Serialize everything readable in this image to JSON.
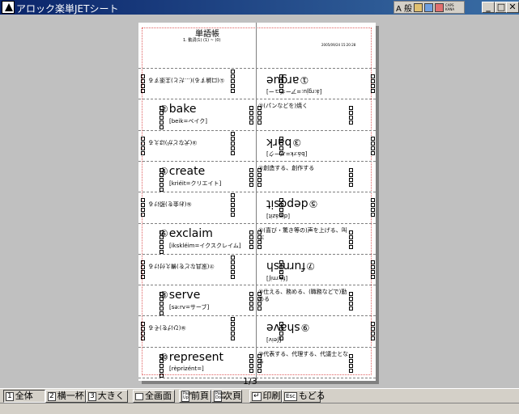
{
  "window": {
    "title": "アロック楽単JETシート"
  },
  "tray": {
    "label": "A 般",
    "extra": "CAPS KANA"
  },
  "header": {
    "title": "単語帳",
    "subtitle": "1. 動詞(1) (1) ~ (0)",
    "date": "2005/09/24 15:20:28"
  },
  "rows": [
    {
      "num": "①",
      "word": "argue",
      "pron": "[á:rgju:=アーギュー]",
      "meaning": "①(口論する)(…だと)主張する",
      "flipped": true
    },
    {
      "num": "②",
      "word": "bake",
      "pron": "[beik=ベイク]",
      "meaning": "②(パンなどを)焼く",
      "flipped": false
    },
    {
      "num": "③",
      "word": "bark",
      "pron": "[bá:rk=バーク]",
      "meaning": "③(犬などが)ほえる",
      "flipped": true
    },
    {
      "num": "④",
      "word": "create",
      "pron": "[kriéit=クリエイト]",
      "meaning": "④創造する、創作する",
      "flipped": false
    },
    {
      "num": "⑤",
      "word": "deposit",
      "pron": "[dipázit]",
      "meaning": "⑤(お金を)預ける",
      "flipped": true
    },
    {
      "num": "⑥",
      "word": "exclaim",
      "pron": "[ikskléim=イクスクレイム]",
      "meaning": "⑥(喜び・驚き等の)声を上げる、叫ぶ",
      "flipped": false
    },
    {
      "num": "⑦",
      "word": "furnish",
      "pron": "[fə́:rniʃ]",
      "meaning": "⑦(家具などを)備え付ける",
      "flipped": true
    },
    {
      "num": "⑧",
      "word": "serve",
      "pron": "[sə:rv=サーブ]",
      "meaning": "⑧仕える、務める、(職務などで)勤める",
      "flipped": false
    },
    {
      "num": "⑨",
      "word": "shave",
      "pron": "[ʃeiv]",
      "meaning": "⑨(ひげを)そる",
      "flipped": true
    },
    {
      "num": "⑩",
      "word": "represent",
      "pron": "[rèprizént=]",
      "meaning": "⑩代表する、代理する、代議士となる",
      "flipped": false
    }
  ],
  "page": {
    "indicator": "1/3"
  },
  "toolbar": {
    "whole": {
      "key": "1",
      "label": "全体"
    },
    "width": {
      "key": "2",
      "label": "横一杯"
    },
    "large": {
      "key": "3",
      "label": "大きく"
    },
    "fullscreen": {
      "key": "",
      "label": "全画面"
    },
    "prev": {
      "key": "Page Up",
      "label": "前頁"
    },
    "next": {
      "key": "Page Down",
      "label": "次頁"
    },
    "print": {
      "key": "↵",
      "label": "印刷"
    },
    "back": {
      "key": "Esc",
      "label": "もどる"
    }
  }
}
